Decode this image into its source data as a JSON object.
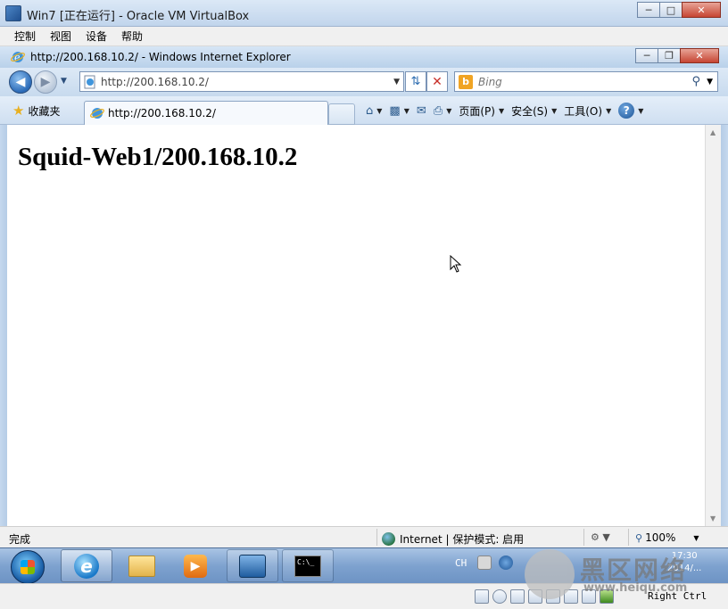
{
  "vbox": {
    "title": "Win7 [正在运行] - Oracle VM VirtualBox",
    "menu": [
      "控制",
      "视图",
      "设备",
      "帮助"
    ],
    "host_key": "Right Ctrl"
  },
  "ie": {
    "title": "http://200.168.10.2/ - Windows Internet Explorer",
    "address": "http://200.168.10.2/",
    "search_placeholder": "Bing",
    "favorites_label": "收藏夹",
    "tab_title": "http://200.168.10.2/",
    "commands": {
      "page": "页面(P)",
      "safety": "安全(S)",
      "tools": "工具(O)"
    },
    "status_text": "完成",
    "zone_text": "Internet | 保护模式: 启用",
    "zoom": "100%"
  },
  "page": {
    "heading": "Squid-Web1/200.168.10.2"
  },
  "taskbar": {
    "language": "CH",
    "clock_time": "17:30",
    "clock_date": "2014/..."
  },
  "watermark": {
    "text": "黑区网络",
    "url": "www.heiqu.com"
  },
  "colors": {
    "title_bar": "#c1d5ec",
    "taskbar": "#7ea2cf",
    "close_button": "#c64533"
  }
}
